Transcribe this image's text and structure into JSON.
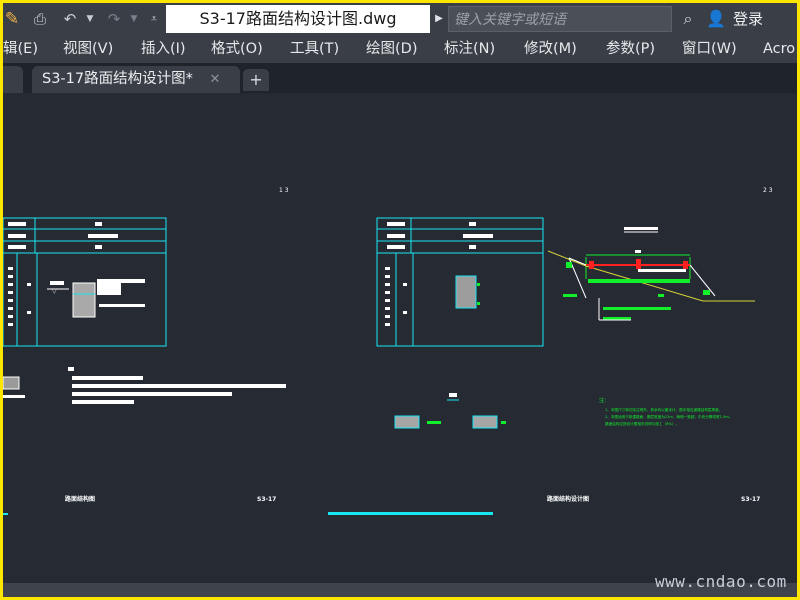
{
  "titlebar": {
    "document_title": "S3-17路面结构设计图.dwg",
    "search_placeholder": "键入关键字或短语",
    "login_label": "登录",
    "icons": [
      "app-icon",
      "print-icon",
      "undo-icon",
      "redo-icon",
      "customize-icon",
      "binoculars-icon",
      "user-icon"
    ]
  },
  "menu": {
    "items": [
      "辑(E)",
      "视图(V)",
      "插入(I)",
      "格式(O)",
      "工具(T)",
      "绘图(D)",
      "标注(N)",
      "修改(M)",
      "参数(P)",
      "窗口(W)",
      "Acro"
    ]
  },
  "tabs": {
    "active_label": "S3-17路面结构设计图*",
    "close_glyph": "✕",
    "new_tab_glyph": "+"
  },
  "drawing": {
    "sheet1_page": "1   3",
    "sheet1_title": "路面结构图",
    "sheet1_code": "S3-17",
    "sheet2_page": "2   3",
    "sheet2_title": "路面结构设计图",
    "sheet2_code": "S3-17",
    "note_label": "注：",
    "notes": [
      "1、本图尺寸单位除注明外，其余均以厘米计，图中相应道路结构层厚度。",
      "2、本图适用于新建路面，基层宽度为22m，两侧一致超，中央分隔带宽1.5m。",
      "路面结构应按设计图相关说明与施工（6%）。"
    ]
  },
  "watermark": "www.cndao.com",
  "colors": {
    "accent_yellow": "#ffe600",
    "cad_background": "#252a33",
    "cad_cyan": "#19e5f0",
    "cad_green": "#12ef2a",
    "cad_red": "#ff2020",
    "cad_yellow": "#d8d23a"
  }
}
